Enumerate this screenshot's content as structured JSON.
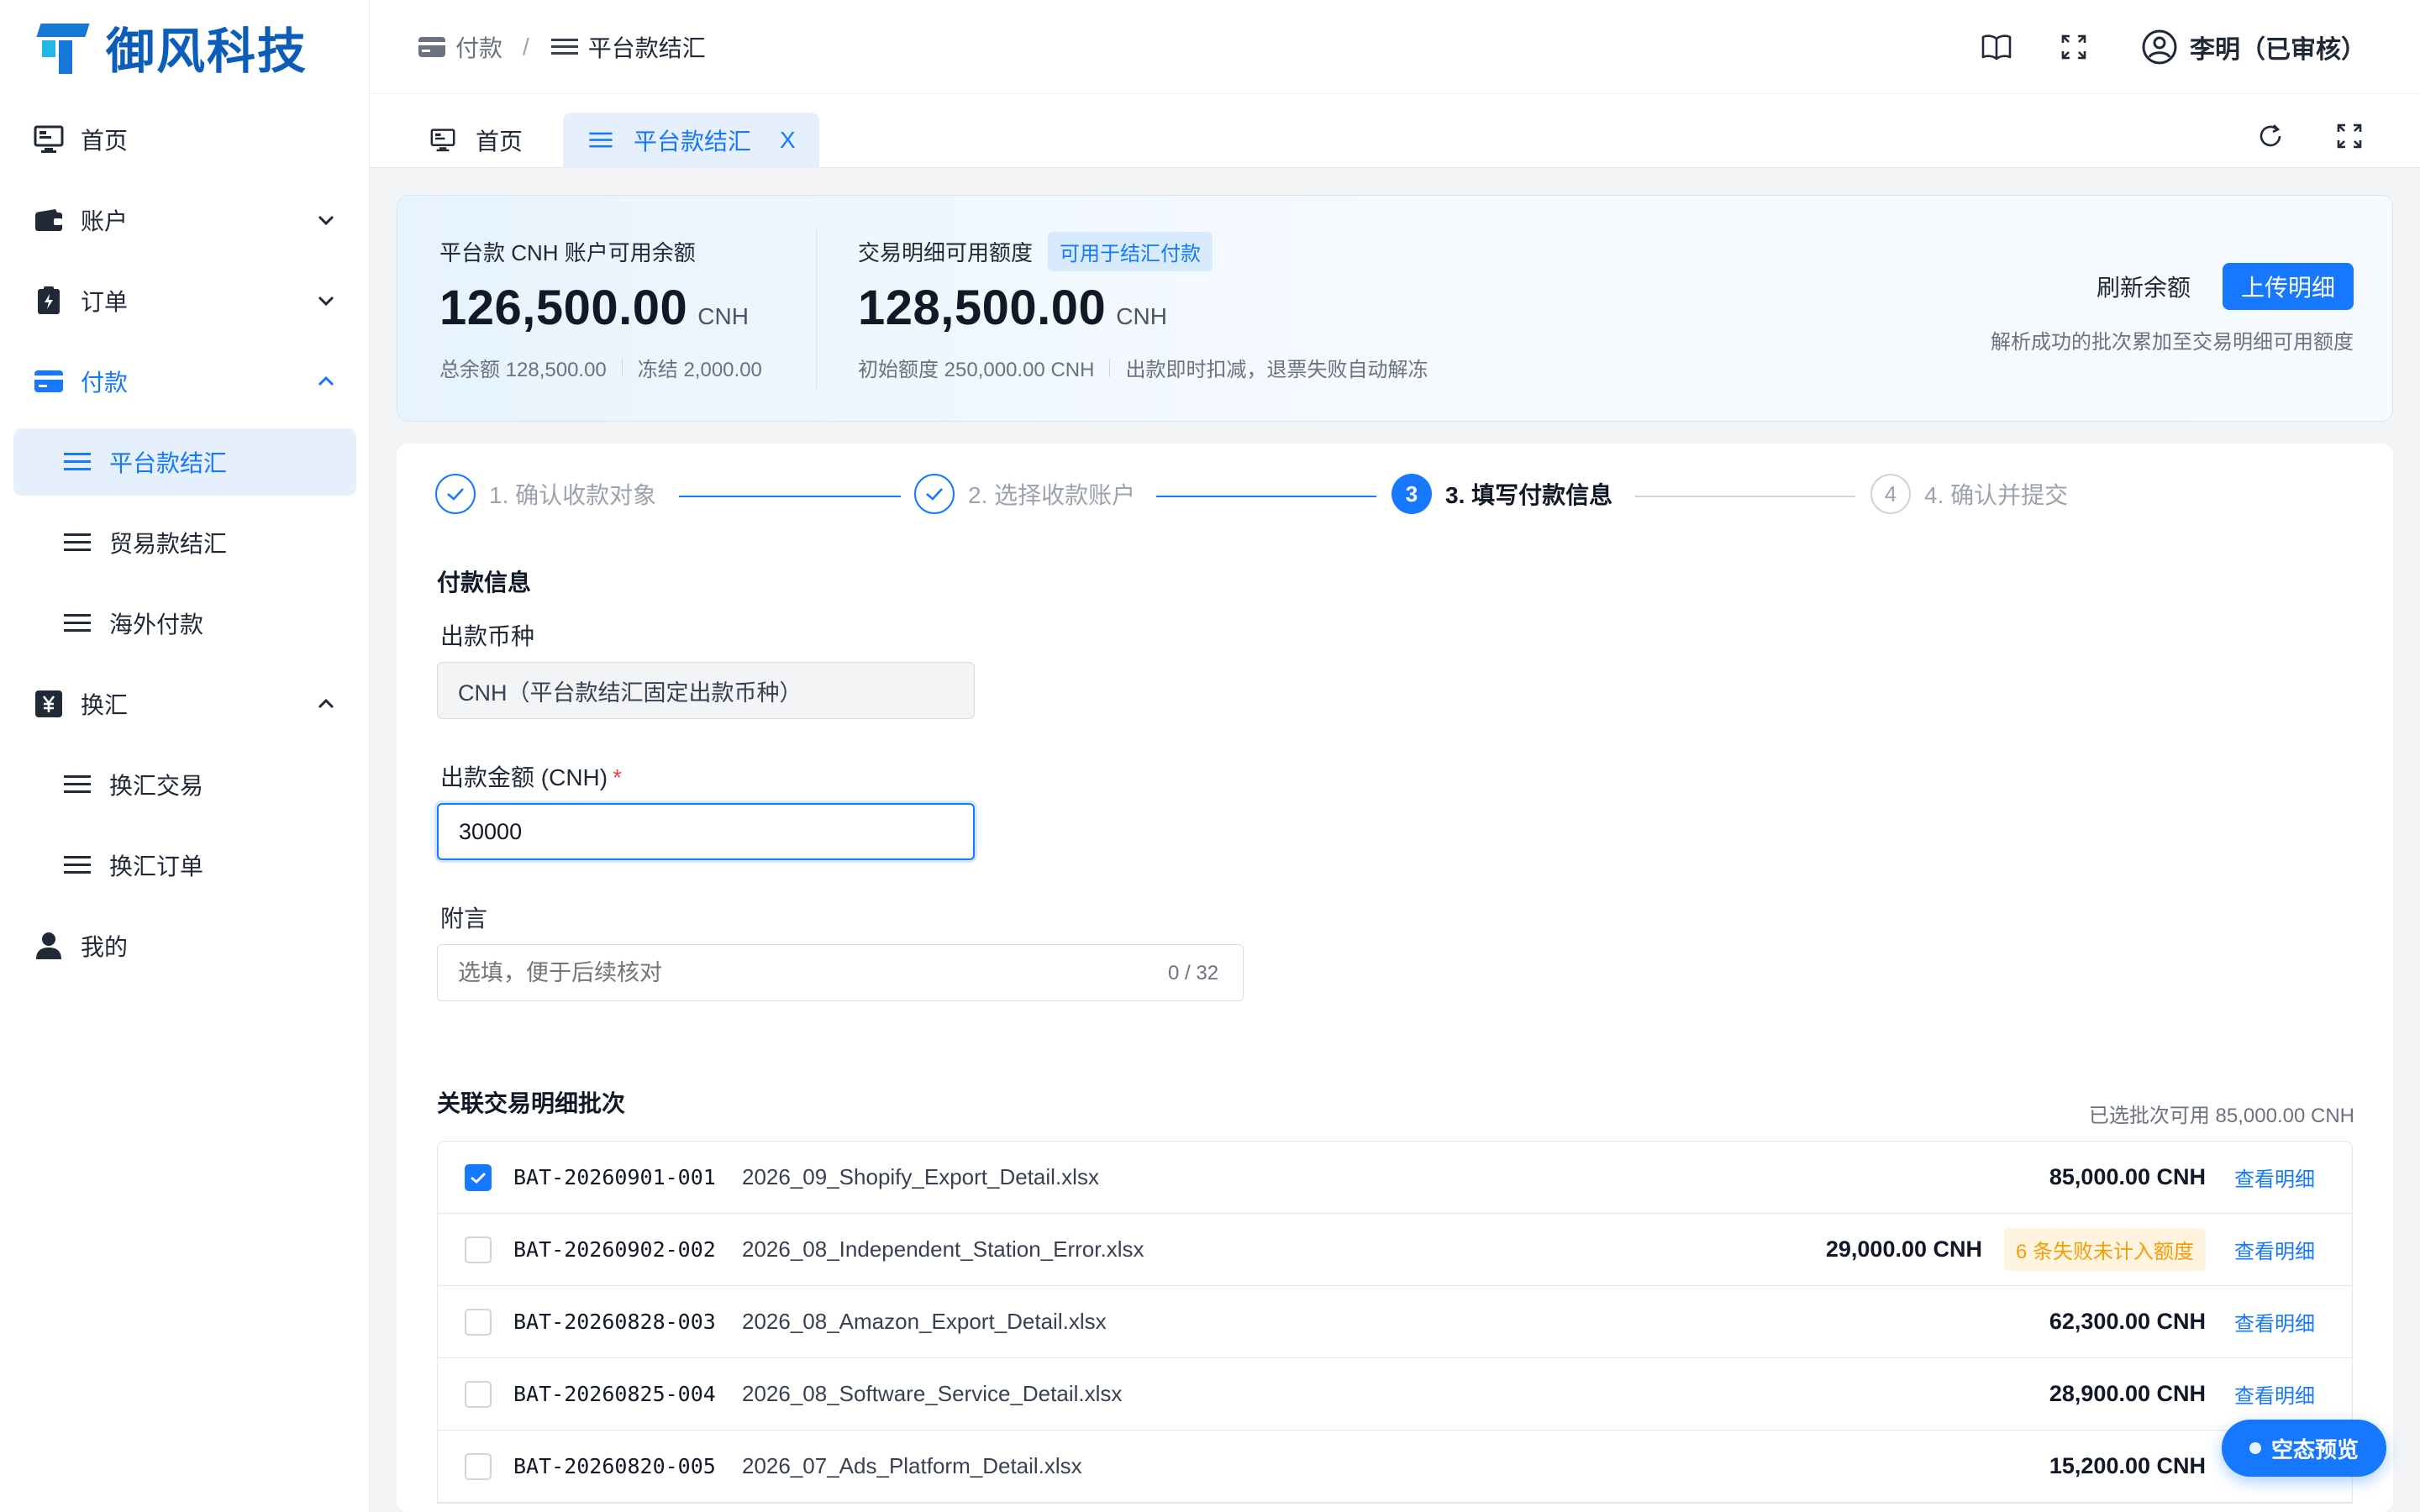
{
  "brand": {
    "name": "御风科技"
  },
  "sidebar": {
    "items": [
      {
        "label": "首页",
        "icon": "monitor-icon"
      },
      {
        "label": "账户",
        "icon": "wallet-icon"
      },
      {
        "label": "订单",
        "icon": "order-icon"
      },
      {
        "label": "付款",
        "icon": "card-icon"
      },
      {
        "label": "换汇",
        "icon": "yen-icon"
      },
      {
        "label": "我的",
        "icon": "user-icon"
      }
    ],
    "payment_sub": [
      "平台款结汇",
      "贸易款结汇",
      "海外付款"
    ],
    "fx_sub": [
      "换汇交易",
      "换汇订单"
    ]
  },
  "header": {
    "breadcrumb": [
      "付款",
      "平台款结汇"
    ],
    "breadcrumb_sep": "/",
    "user": "李明（已审核）"
  },
  "tabs": [
    {
      "label": "首页"
    },
    {
      "label": "平台款结汇",
      "close": "X"
    }
  ],
  "balance": {
    "platform": {
      "label": "平台款 CNH 账户可用余额",
      "amount": "126,500.00",
      "currency": "CNH",
      "total": "总余额 128,500.00",
      "frozen": "冻结 2,000.00"
    },
    "detail": {
      "label": "交易明细可用额度",
      "tag": "可用于结汇付款",
      "amount": "128,500.00",
      "currency": "CNH",
      "initial": "初始额度 250,000.00 CNH",
      "note": "出款即时扣减，退票失败自动解冻"
    },
    "refresh_label": "刷新余额",
    "upload_label": "上传明细",
    "upload_note": "解析成功的批次累加至交易明细可用额度"
  },
  "steps": [
    {
      "label": "1. 确认收款对象",
      "state": "done"
    },
    {
      "label": "2. 选择收款账户",
      "state": "done"
    },
    {
      "label": "3. 填写付款信息",
      "state": "current",
      "num": "3"
    },
    {
      "label": "4. 确认并提交",
      "state": "todo",
      "num": "4"
    }
  ],
  "form": {
    "section_title": "付款信息",
    "currency_label": "出款币种",
    "currency_value": "CNH（平台款结汇固定出款币种）",
    "amount_label": "出款金额 (CNH)",
    "amount_required": "*",
    "amount_value": "30000",
    "memo_label": "附言",
    "memo_placeholder": "选填，便于后续核对",
    "memo_counter": "0 / 32"
  },
  "batches": {
    "title": "关联交易明细批次",
    "selected_summary": "已选批次可用 85,000.00 CNH",
    "view_label": "查看明细",
    "rows": [
      {
        "id": "BAT-20260901-001",
        "file": "2026_09_Shopify_Export_Detail.xlsx",
        "amount": "85,000.00 CNH",
        "checked": true
      },
      {
        "id": "BAT-20260902-002",
        "file": "2026_08_Independent_Station_Error.xlsx",
        "amount": "29,000.00 CNH",
        "checked": false,
        "warning": "6 条失败未计入额度"
      },
      {
        "id": "BAT-20260828-003",
        "file": "2026_08_Amazon_Export_Detail.xlsx",
        "amount": "62,300.00 CNH",
        "checked": false
      },
      {
        "id": "BAT-20260825-004",
        "file": "2026_08_Software_Service_Detail.xlsx",
        "amount": "28,900.00 CNH",
        "checked": false
      },
      {
        "id": "BAT-20260820-005",
        "file": "2026_07_Ads_Platform_Detail.xlsx",
        "amount": "15,200.00 CNH",
        "checked": false
      }
    ]
  },
  "fab": {
    "label": "空态预览"
  },
  "colors": {
    "primary": "#1677ff",
    "brand": "#0a5db8",
    "warning": "#f59e0b",
    "required": "#ef4444"
  }
}
